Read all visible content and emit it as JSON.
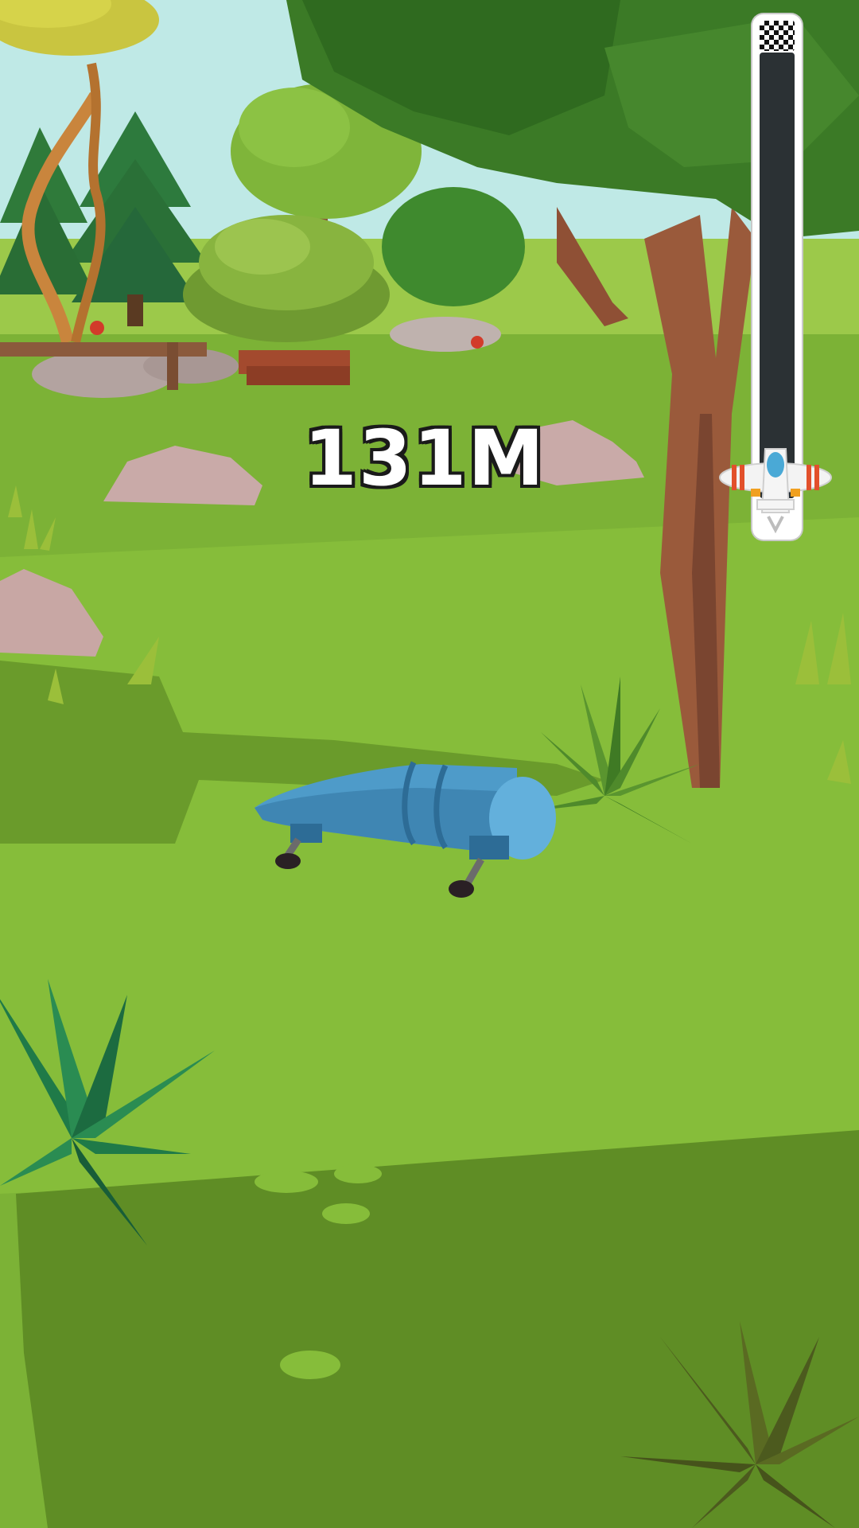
{
  "hud": {
    "distance_label": "131M",
    "progress_fraction": 0.04
  },
  "icons": {
    "finish": "checkered-flag-icon",
    "player": "airplane-icon"
  },
  "colors": {
    "grass": "#7cb236",
    "grass_shadow": "#5f8d25",
    "sky": "#bfe9e6",
    "track": "#2b3134",
    "rocket": "#4e9bc9"
  }
}
